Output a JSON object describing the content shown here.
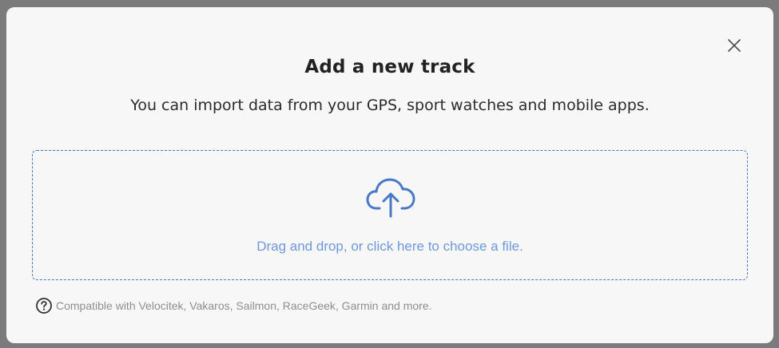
{
  "modal": {
    "title": "Add a new track",
    "subtitle": "You can import data from your GPS, sport watches and mobile apps.",
    "close_icon": "close-icon",
    "dropzone": {
      "icon": "cloud-upload-icon",
      "text": "Drag and drop, or click here to choose a file."
    },
    "footer": {
      "icon": "question-circle-icon",
      "text": "Compatible with Velocitek, Vakaros, Sailmon, RaceGeek, Garmin and more."
    }
  },
  "colors": {
    "accent": "#4a78c9",
    "dropzone_text": "#6f98dc",
    "backdrop": "#7b7b7b",
    "modal_bg": "#f7f7f7"
  }
}
